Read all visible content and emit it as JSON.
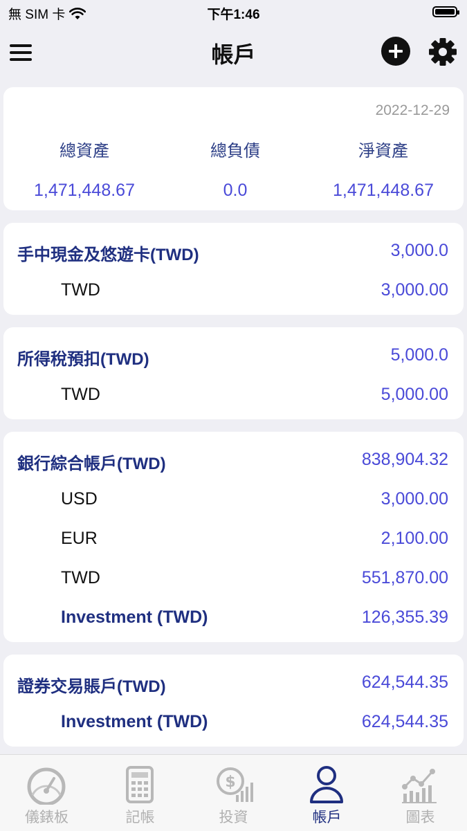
{
  "status": {
    "carrier": "無 SIM 卡",
    "time": "下午1:46"
  },
  "nav": {
    "title": "帳戶"
  },
  "summary": {
    "date": "2022-12-29",
    "total_assets_label": "總資產",
    "total_assets": "1,471,448.67",
    "total_liabilities_label": "總負債",
    "total_liabilities": "0.0",
    "net_assets_label": "淨資產",
    "net_assets": "1,471,448.67"
  },
  "accounts": [
    {
      "name": "手中現金及悠遊卡(TWD)",
      "amount": "3,000.0",
      "items": [
        {
          "name": "TWD",
          "amount": "3,000.00"
        }
      ]
    },
    {
      "name": "所得稅預扣(TWD)",
      "amount": "5,000.0",
      "items": [
        {
          "name": "TWD",
          "amount": "5,000.00"
        }
      ]
    },
    {
      "name": "銀行綜合帳戶(TWD)",
      "amount": "838,904.32",
      "items": [
        {
          "name": "USD",
          "amount": "3,000.00"
        },
        {
          "name": "EUR",
          "amount": "2,100.00"
        },
        {
          "name": "TWD",
          "amount": "551,870.00"
        },
        {
          "name": "Investment (TWD)",
          "amount": "126,355.39"
        }
      ]
    },
    {
      "name": "證券交易賬戶(TWD)",
      "amount": "624,544.35",
      "items": [
        {
          "name": "Investment (TWD)",
          "amount": "624,544.35"
        }
      ]
    }
  ],
  "tabs": [
    {
      "label": "儀錶板",
      "icon": "dashboard-gauge-icon"
    },
    {
      "label": "記帳",
      "icon": "ledger-calculator-icon"
    },
    {
      "label": "投資",
      "icon": "investment-dollar-chart-icon"
    },
    {
      "label": "帳戶",
      "icon": "person-account-icon",
      "active": true
    },
    {
      "label": "圖表",
      "icon": "line-bar-chart-icon"
    }
  ],
  "colors": {
    "accent": "#1f2f80",
    "amount": "#4a4ad8",
    "inactive_tab": "#b0b0b0",
    "background": "#efeff4"
  }
}
